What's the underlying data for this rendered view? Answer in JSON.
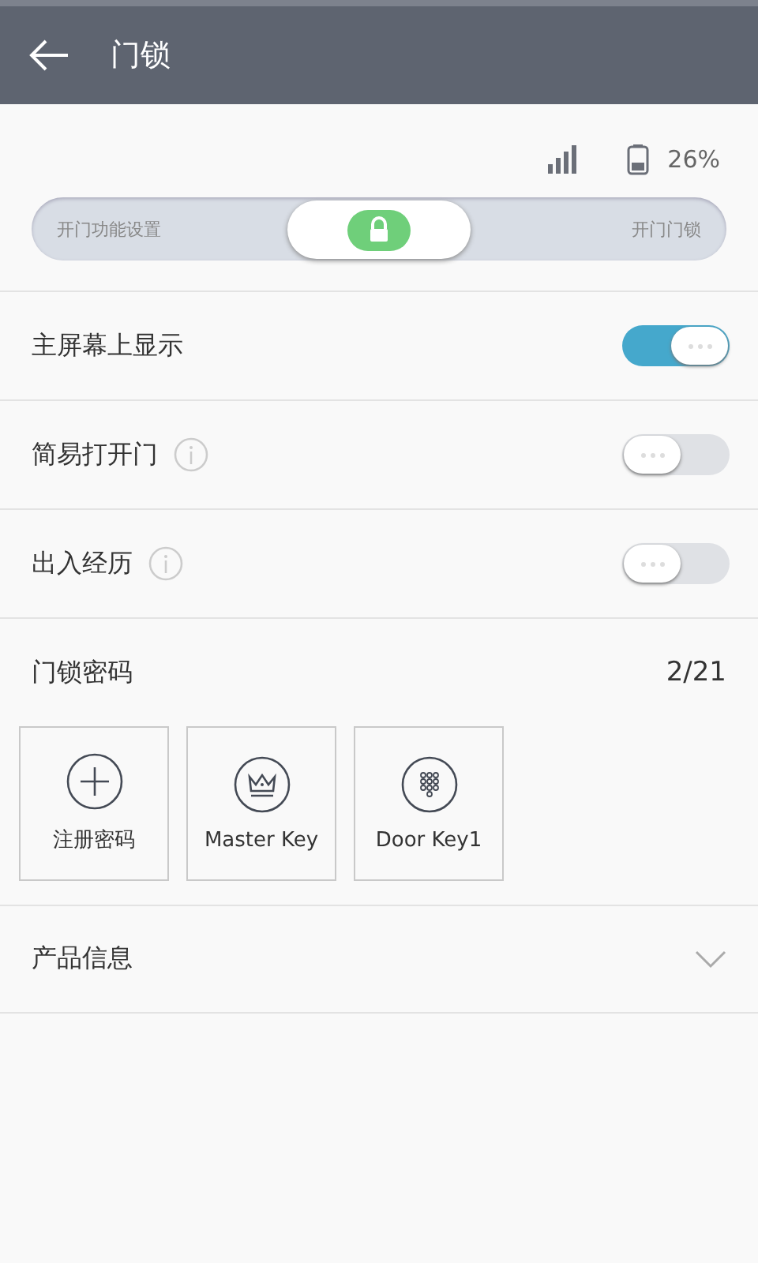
{
  "header": {
    "title": "门锁"
  },
  "status": {
    "battery": "26%"
  },
  "lock_slider": {
    "left_label": "开门功能设置",
    "right_label": "开门门锁",
    "level": 0.5
  },
  "settings": [
    {
      "label": "主屏幕上显示",
      "info": false,
      "on": true
    },
    {
      "label": "简易打开门",
      "info": true,
      "on": false
    },
    {
      "label": "出入经历",
      "info": true,
      "on": false
    }
  ],
  "keys": {
    "title": "门锁密码",
    "count": "2/21",
    "items": [
      {
        "kind": "add",
        "label": "注册密码"
      },
      {
        "kind": "master",
        "label": "Master Key"
      },
      {
        "kind": "door",
        "label": "Door Key1"
      }
    ]
  },
  "product": {
    "label": "产品信息",
    "expanded": false
  }
}
